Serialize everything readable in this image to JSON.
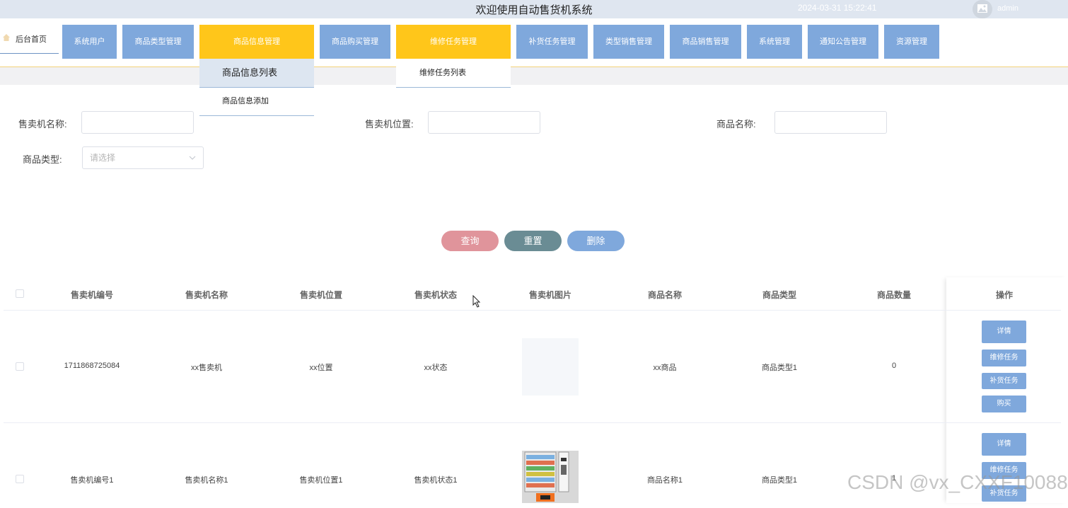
{
  "header": {
    "title": "欢迎使用自动售货机系统",
    "datetime": "2024-03-31 15:22:41",
    "username": "admin"
  },
  "nav": {
    "home": "后台首页",
    "items": [
      "系统用户",
      "商品类型管理",
      "商品信息管理",
      "商品购买管理",
      "维修任务管理",
      "补货任务管理",
      "类型销售管理",
      "商品销售管理",
      "系统管理",
      "通知公告管理",
      "资源管理"
    ],
    "submenu_goods": [
      "商品信息列表",
      "商品信息添加"
    ],
    "submenu_repair": [
      "维修任务列表"
    ]
  },
  "filters": {
    "machine_name_label": "售卖机名称:",
    "machine_location_label": "售卖机位置:",
    "goods_name_label": "商品名称:",
    "goods_type_label": "商品类型:",
    "goods_type_placeholder": "请选择"
  },
  "buttons": {
    "query": "查询",
    "reset": "重置",
    "delete": "删除"
  },
  "colors": {
    "query": "#e0949b",
    "reset": "#6a8c94",
    "delete": "#7fa8dc",
    "nav": "#7fa8dc",
    "nav_active": "#ffc61a"
  },
  "table": {
    "columns": [
      "售卖机编号",
      "售卖机名称",
      "售卖机位置",
      "售卖机状态",
      "售卖机图片",
      "商品名称",
      "商品类型",
      "商品数量",
      "操作"
    ],
    "rows": [
      [
        "1711868725084",
        "xx售卖机",
        "xx位置",
        "xx状态",
        "",
        "xx商品",
        "商品类型1",
        "0"
      ],
      [
        "售卖机编号1",
        "售卖机名称1",
        "售卖机位置1",
        "售卖机状态1",
        "",
        "商品名称1",
        "商品类型1",
        "1"
      ]
    ],
    "actions": [
      "详情",
      "维修任务",
      "补货任务",
      "购买"
    ]
  },
  "watermark": "CSDN @vx_CXXF10088"
}
